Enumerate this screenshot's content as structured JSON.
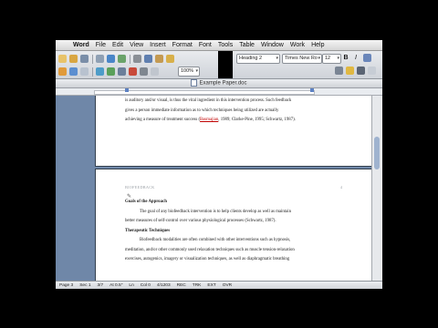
{
  "menubar": {
    "apple": "",
    "items": [
      "Word",
      "File",
      "Edit",
      "View",
      "Insert",
      "Format",
      "Font",
      "Tools",
      "Table",
      "Window",
      "Work",
      "Help"
    ]
  },
  "toolbar": {
    "zoom": "100%",
    "style": "Heading 2",
    "font": "Times New Ro",
    "size": "12",
    "bold": "B",
    "italic": "I"
  },
  "window": {
    "title": "Example Paper.doc"
  },
  "page1": {
    "lines": [
      "is auditory and/or visual, is thus the vital ingredient in this intervention process. Such feedback",
      "gives a person immediate information as to which techniques being utilized are actually",
      "achieving a measure of treatment success ("
    ],
    "cite": "Basmajian",
    "cite_rest": ", 1989; Clarke-Pine, 1995; Schwartz, 1987)."
  },
  "page2": {
    "running_head": "BIOFEEDBACK",
    "page_number": "4",
    "heading1": "Goals of the Approach",
    "para1": [
      "The goal of any biofeedback intervention is to help clients develop as well as maintain",
      "better measures of self-control over various physiological processes (Schwartz, 1987)."
    ],
    "heading2": "Therapeutic Techniques",
    "para2": [
      "Biofeedback modalities are often combined with other interventions such as hypnosis,",
      "meditation, and/or other commonly used relaxation techniques such as muscle tension-relaxation",
      "exercises, autogenics, imagery or visualization techniques, as well as diaphragmatic breathing"
    ]
  },
  "status": {
    "page": "Page 3",
    "sec": "Sec 1",
    "pages": "3/7",
    "at": "At 0.5\"",
    "ln": "Ln",
    "col": "Col 0",
    "words": "4/1203",
    "rec": "REC",
    "trk": "TRK",
    "ext": "EXT",
    "ovr": "OVR"
  },
  "colors": {
    "workspace": "#6f87a8",
    "accent": "#5d82c4",
    "cite": "#c00000"
  }
}
